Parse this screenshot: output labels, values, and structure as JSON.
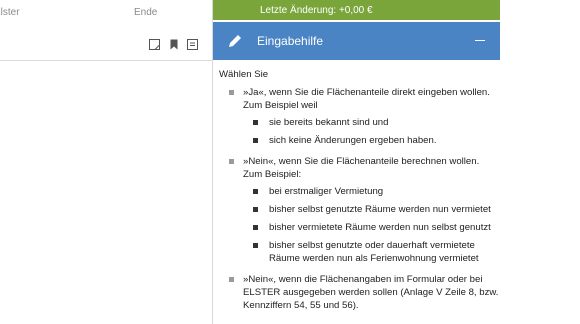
{
  "nav": {
    "elster_label": "Elster",
    "ende_label": "Ende"
  },
  "toolbar": {
    "icons": [
      "note-icon",
      "bookmark-icon",
      "list-icon"
    ]
  },
  "change_bar": {
    "text": "Letzte Änderung: +0,00 €"
  },
  "help": {
    "title": "Eingabehilfe",
    "intro": "Wählen Sie",
    "items": [
      {
        "text": "»Ja«, wenn Sie die Flächenanteile direkt eingeben wollen. Zum Beispiel weil",
        "sub": [
          "sie bereits bekannt sind und",
          "sich keine Änderungen ergeben haben."
        ]
      },
      {
        "text": "»Nein«, wenn Sie die Flächenanteile berechnen wollen. Zum Beispiel:",
        "sub": [
          "bei erstmaliger Vermietung",
          "bisher selbst genutzte Räume werden nun vermietet",
          "bisher vermietete Räume werden nun selbst genutzt",
          "bisher selbst genutzte oder dauerhaft vermietete Räume werden nun als Ferienwohnung vermietet"
        ]
      },
      {
        "text": "»Nein«, wenn die Flächenangaben im Formular oder bei ELSTER ausgegeben werden sollen (Anlage V Zeile 8, bzw. Kennziffern 54, 55 und 56).",
        "sub": []
      }
    ]
  },
  "colors": {
    "change_bar": "#7aa53a",
    "help_header": "#4a84c4"
  }
}
